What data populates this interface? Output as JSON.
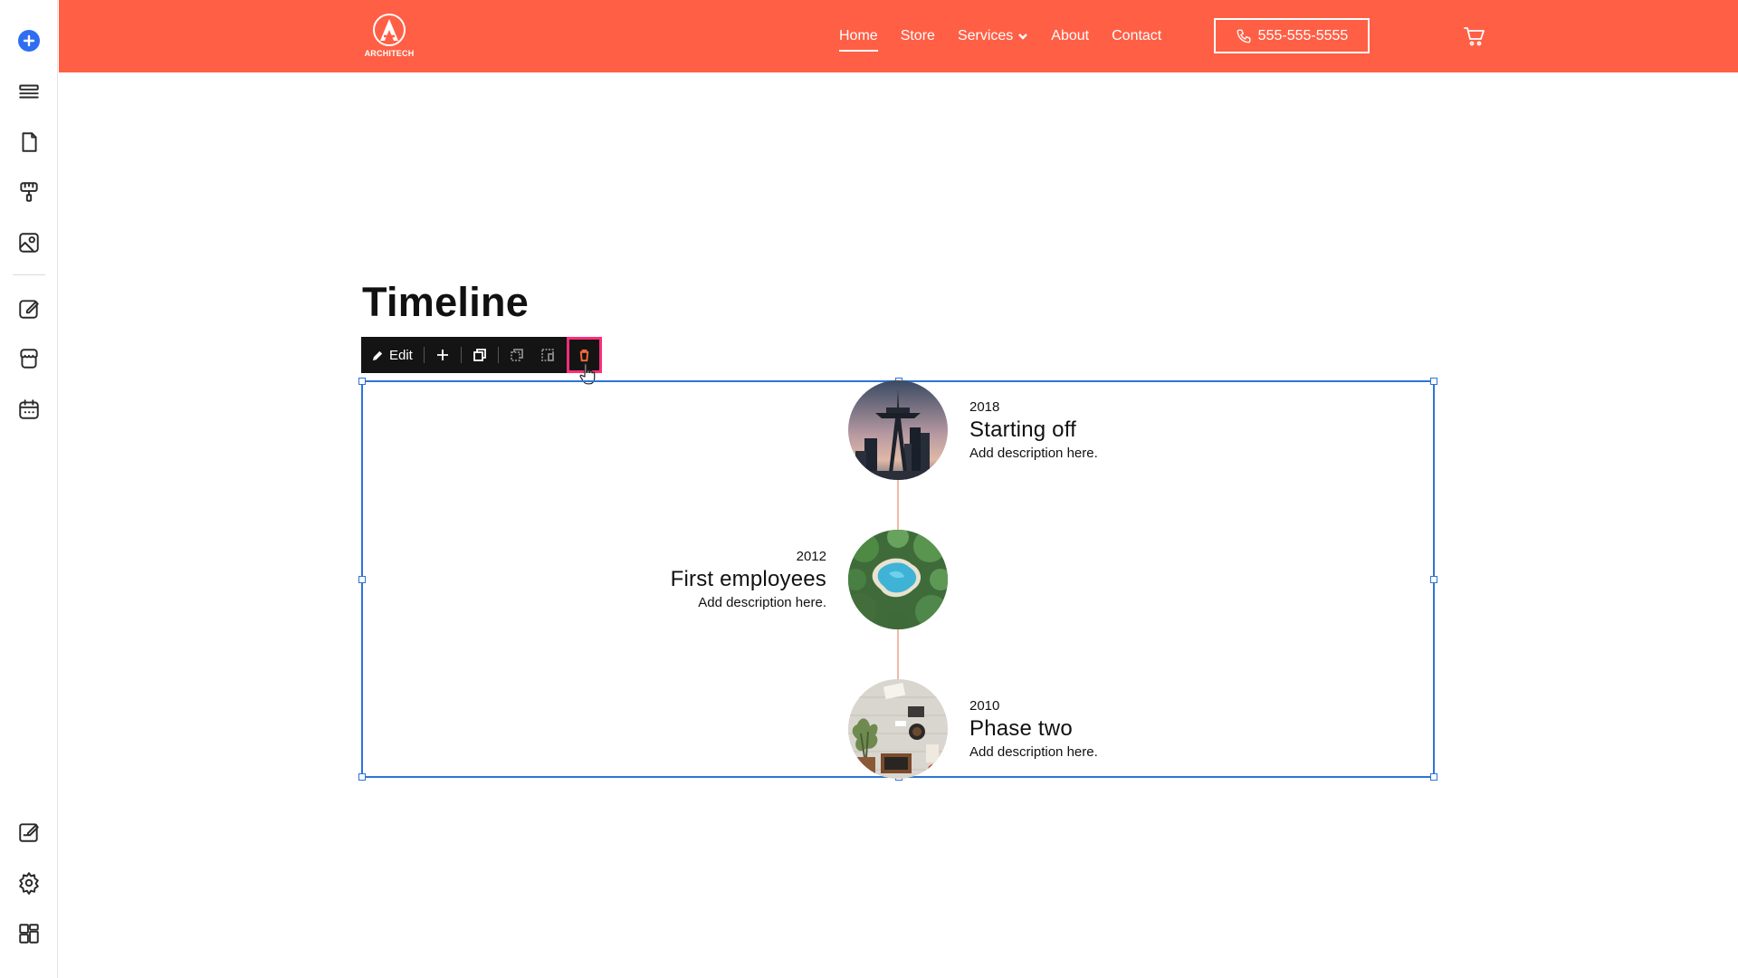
{
  "header": {
    "logo_text": "ARCHITECH",
    "nav": [
      {
        "label": "Home",
        "active": true
      },
      {
        "label": "Store",
        "active": false
      },
      {
        "label": "Services",
        "active": false,
        "has_dropdown": true
      },
      {
        "label": "About",
        "active": false
      },
      {
        "label": "Contact",
        "active": false
      }
    ],
    "phone": "555-555-5555",
    "cart_icon": "cart-icon"
  },
  "colors": {
    "header_bg": "#ff5f45",
    "selection": "#2e74d6",
    "delete_highlight": "#ff2e7a",
    "add_button": "#2f6ef2"
  },
  "rail": {
    "icons": [
      "add-icon",
      "layers-icon",
      "page-icon",
      "paint-roller-icon",
      "image-icon",
      "edit-icon",
      "store-icon",
      "calendar-icon",
      "blog-edit-icon",
      "gear-icon",
      "dashboard-icon"
    ]
  },
  "content": {
    "title": "Timeline"
  },
  "toolbar": {
    "edit_label": "Edit",
    "tools": [
      "pencil-icon",
      "plus-icon",
      "duplicate-icon",
      "copy-style-icon",
      "paste-style-icon",
      "trash-icon"
    ]
  },
  "timeline": {
    "items": [
      {
        "year": "2018",
        "title": "Starting off",
        "description": "Add description here.",
        "side": "right",
        "image": "space-needle-photo"
      },
      {
        "year": "2012",
        "title": "First employees",
        "description": "Add description here.",
        "side": "left",
        "image": "pool-aerial-photo"
      },
      {
        "year": "2010",
        "title": "Phase two",
        "description": "Add description here.",
        "side": "right",
        "image": "desk-flatlay-photo"
      }
    ]
  }
}
